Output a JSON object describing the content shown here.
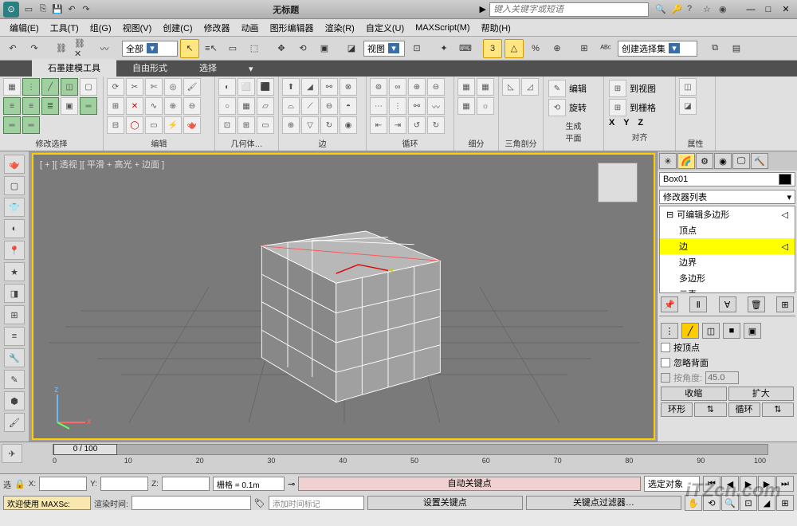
{
  "title": "无标题",
  "search_placeholder": "键入关键字或短语",
  "menu": {
    "edit": "编辑(E)",
    "tools": "工具(T)",
    "group": "组(G)",
    "views": "视图(V)",
    "create": "创建(C)",
    "modifiers": "修改器",
    "animation": "动画",
    "graph": "图形编辑器",
    "render": "渲染(R)",
    "customize": "自定义(U)",
    "maxscript": "MAXScript(M)",
    "help": "帮助(H)"
  },
  "toolbar": {
    "filter_all": "全部",
    "view_combo": "视图",
    "angle": "3",
    "create_sel_set": "创建选择集"
  },
  "ribbon": {
    "tab1": "石墨建模工具",
    "tab2": "自由形式",
    "tab3": "选择",
    "g_modify": "修改选择",
    "g_edit": "编辑",
    "g_geom": "几何体…",
    "g_edge": "边",
    "g_loop": "循环",
    "g_subdiv": "细分",
    "g_tri": "三角剖分",
    "g_align": "对齐",
    "g_prop": "属性",
    "align_edit": "编辑",
    "align_rotate": "旋转",
    "align_genplane": "生成\n平面",
    "align_toview": "到视图",
    "align_togrid": "到栅格",
    "xyz": "X  Y  Z"
  },
  "viewport": {
    "label": "[ + ][ 透视 ][ 平滑 + 高光 + 边面 ]"
  },
  "panel": {
    "object_name": "Box01",
    "mod_list": "修改器列表",
    "stack_root": "可编辑多边形",
    "sub_vertex": "顶点",
    "sub_edge": "边",
    "sub_border": "边界",
    "sub_poly": "多边形",
    "sub_element": "元素",
    "by_vertex": "按顶点",
    "ignore_back": "忽略背面",
    "by_angle": "按角度:",
    "angle_val": "45.0",
    "shrink": "收缩",
    "grow": "扩大",
    "ring": "环形",
    "loop": "循环"
  },
  "timeline": {
    "frame": "0 / 100",
    "t0": "0",
    "t10": "10",
    "t20": "20",
    "t30": "30",
    "t40": "40",
    "t50": "50",
    "t60": "60",
    "t70": "70",
    "t80": "80",
    "t90": "90",
    "t100": "100"
  },
  "status": {
    "welcome": "欢迎使用 MAXSc:",
    "sel_label": "选",
    "x_label": "X:",
    "y_label": "Y:",
    "z_label": "Z:",
    "grid": "栅格 = 0.1m",
    "render_time": "渲染时间:",
    "add_marker": "添加时间标记",
    "auto_key": "自动关键点",
    "set_key": "设置关键点",
    "sel_obj": "选定对象",
    "key_filter": "关键点过滤器…"
  },
  "watermark": "iTZcn.com"
}
